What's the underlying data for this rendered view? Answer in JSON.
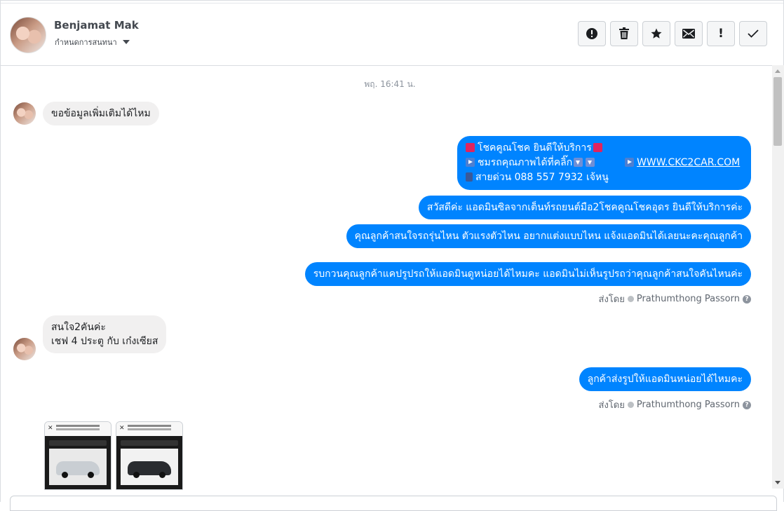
{
  "header": {
    "contact_name": "Benjamat Mak",
    "assign_label": "กำหนดการสนทนา"
  },
  "toolbar": {
    "buttons": [
      {
        "name": "spam",
        "icon": "alert-circle-icon"
      },
      {
        "name": "delete",
        "icon": "trash-icon"
      },
      {
        "name": "star",
        "icon": "star-icon"
      },
      {
        "name": "mark-unread",
        "icon": "envelope-icon"
      },
      {
        "name": "important",
        "icon": "exclamation-icon",
        "label": "!"
      },
      {
        "name": "done",
        "icon": "check-icon"
      }
    ]
  },
  "conversation": {
    "timestamp": "พฤ. 16:41 น.",
    "messages": [
      {
        "from": "customer",
        "text": "ขอข้อมูลเพิ่มเติมได้ไหม"
      },
      {
        "from": "page",
        "lines": [
          "โชคคูณโชค ยินดีให้บริการ",
          "ชมรถคุณภาพได้ที่คลิ๊ก",
          "WWW.CKC2CAR.COM",
          "สายด่วน 088 557 7932 เจ้หนู"
        ]
      },
      {
        "from": "page",
        "text": "สวัสดีค่ะ แอดมินซิลจากเต็นท์รถยนต์มือ2โชคคูณโชคอุดร ยินดีให้บริการค่ะ"
      },
      {
        "from": "page",
        "text": "คุณลูกค้าสนใจรถรุ่นไหน ตัวแรงตัวไหน อยากแต่งแบบไหน แจ้งแอดมินได้เลยนะคะคุณลูกค้า"
      },
      {
        "from": "page",
        "text": "รบกวนคุณลูกค้าแคปรูปรถให้แอดมินดูหน่อยได้ไหมคะ แอดมินไม่เห็นรูปรถว่าคุณลูกค้าสนใจคันไหนค่ะ"
      },
      {
        "from": "customer",
        "lines": [
          "สนใจ2คันค่ะ",
          "เชฟ 4 ประตู กับ เก๋งเซียส"
        ]
      },
      {
        "from": "page",
        "text": "ลูกค้าส่งรูปให้แอดมินหน่อยได้ไหมคะ"
      }
    ],
    "sent_by_label": "ส่งโดย",
    "sent_by_name": "Prathumthong Passorn",
    "help_glyph": "?"
  },
  "colors": {
    "outgoing_bubble": "#0084ff",
    "incoming_bubble": "#f1f0f0"
  }
}
